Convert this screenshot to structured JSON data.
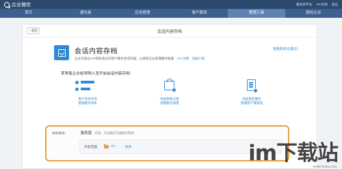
{
  "topbar": {
    "brand": "企业微信",
    "links": [
      "服务商平台",
      "API文档",
      "退出"
    ]
  },
  "nav": {
    "items": [
      "首页",
      "通讯录",
      "应用管理",
      "客户联系",
      "管理工具",
      "我的企业"
    ],
    "active_index": 4
  },
  "panel": {
    "back_label": "‹ 返回",
    "title": "会话内容存档"
  },
  "feature": {
    "title": "会话内容存档",
    "desc": "企业可通过API获取成员的客户服务会话内容，以满足企业管理服务质量",
    "api_link": "API 文档",
    "intro_link": "功能介绍",
    "pricing_link": "查看购买记录(0)"
  },
  "scenarios": {
    "heading": "某零售企业给导购人员开启会话内容存档：",
    "items": [
      {
        "label": "客户购买咨询\n管理服务效率",
        "icon": "users-chat-icon"
      },
      {
        "label": "商品销售过程\n管理服务质量",
        "icon": "shopping-bag-icon"
      },
      {
        "label": "商品售后服务\n管理客户满意度",
        "icon": "clipboard-check-icon"
      }
    ]
  },
  "version": {
    "label": "体验版本",
    "name": "服务版",
    "name_desc": "内容、外部服务沟通服务管理",
    "row_key": "开启范围",
    "row_value": "DY",
    "row_edit": "修改"
  },
  "watermark": {
    "text": "im下载站",
    "sub": "www.imxia.com"
  },
  "colors": {
    "topbar": "#2b4a6e",
    "nav": "#3d6090",
    "nav_active": "#5d82b3",
    "accent": "#2f8ad8",
    "highlight_border": "#e9a03a"
  }
}
